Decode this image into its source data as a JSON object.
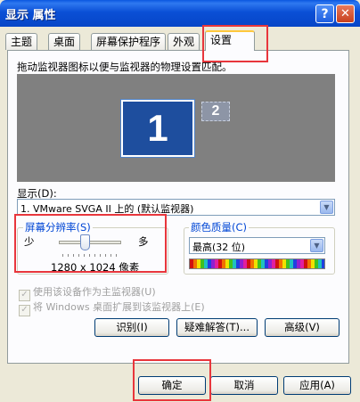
{
  "window": {
    "title": "显示 属性",
    "help_label": "?",
    "close_label": "✕"
  },
  "tabs": [
    {
      "label": "主题"
    },
    {
      "label": "桌面"
    },
    {
      "label": "屏幕保护程序"
    },
    {
      "label": "外观"
    },
    {
      "label": "设置",
      "active": true
    }
  ],
  "settings": {
    "description": "拖动监视器图标以便与监视器的物理设置匹配。",
    "monitor_primary": "1",
    "monitor_secondary": "2",
    "display_label": "显示(D):",
    "display_value": "1. VMware SVGA II 上的 (默认监视器)",
    "resolution": {
      "title": "屏幕分辨率(S)",
      "min_label": "少",
      "max_label": "多",
      "value": "1280 x 1024 像素"
    },
    "color_quality": {
      "title": "颜色质量(C)",
      "value": "最高(32 位)"
    },
    "checkbox_primary": "使用该设备作为主监视器(U)",
    "checkbox_extend": "将 Windows 桌面扩展到该监视器上(E)",
    "btn_identify": "识别(I)",
    "btn_troubleshoot": "疑难解答(T)...",
    "btn_advanced": "高级(V)"
  },
  "footer": {
    "ok": "确定",
    "cancel": "取消",
    "apply": "应用(A)"
  },
  "colors": {
    "title_bar": "#0a4fd6",
    "dialog_bg": "#ece9d8",
    "monitor_selected": "#1e4e9e",
    "highlight_box": "#e8363c",
    "group_title": "#0046d5"
  }
}
